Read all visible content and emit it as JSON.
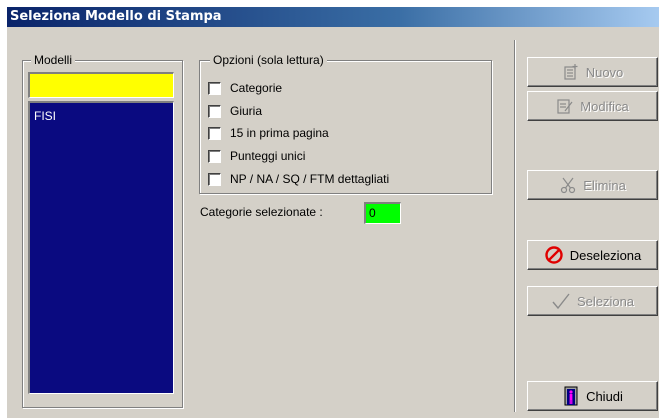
{
  "window": {
    "title": "Seleziona Modello di Stampa"
  },
  "modelli": {
    "legend": "Modelli",
    "input_value": "",
    "items": [
      "FISI"
    ]
  },
  "opzioni": {
    "legend": "Opzioni  (sola lettura)",
    "options": [
      {
        "label": "Categorie",
        "checked": false
      },
      {
        "label": "Giuria",
        "checked": false
      },
      {
        "label": "15 in prima pagina",
        "checked": false
      },
      {
        "label": "Punteggi unici",
        "checked": false
      },
      {
        "label": "NP / NA / SQ / FTM dettagliati",
        "checked": false
      }
    ]
  },
  "selection": {
    "label": "Categorie selezionate :",
    "value": "0"
  },
  "buttons": {
    "nuovo": "Nuovo",
    "modifica": "Modifica",
    "elimina": "Elimina",
    "deseleziona": "Deseleziona",
    "seleziona": "Seleziona",
    "chiudi": "Chiudi"
  },
  "colors": {
    "title_bar": "#0a246a",
    "list_bg": "#0a0a80",
    "input_bg": "#ffff00",
    "counter_bg": "#00ff00",
    "deseleziona_icon": "#e00000"
  },
  "icons": {
    "nuovo": "new-document-icon",
    "modifica": "edit-document-icon",
    "elimina": "scissors-icon",
    "deseleziona": "no-entry-icon",
    "seleziona": "checkmark-icon",
    "chiudi": "door-exit-icon"
  }
}
